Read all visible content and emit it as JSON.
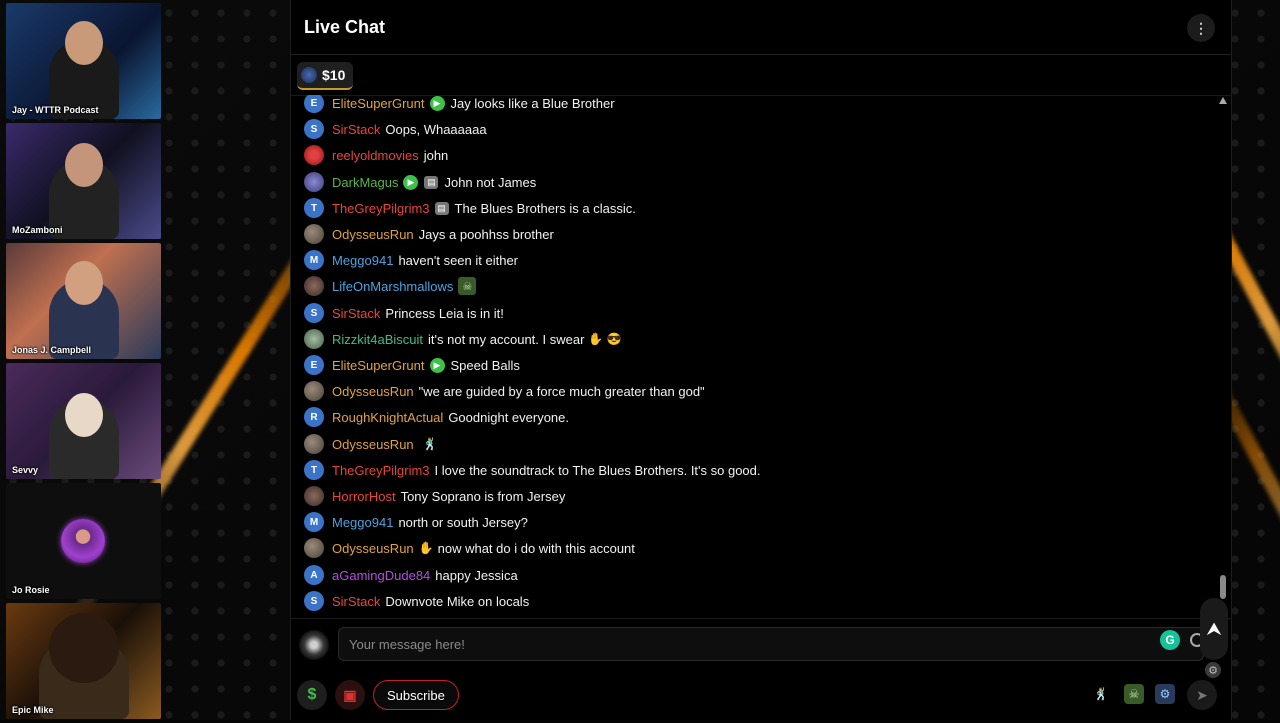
{
  "webcams": [
    {
      "name": "Jay - WTTR Podcast"
    },
    {
      "name": "MoZamboni"
    },
    {
      "name": "Jonas J. Campbell"
    },
    {
      "name": "Sevvy"
    },
    {
      "name": "Jo Rosie"
    },
    {
      "name": "Epic Mike"
    }
  ],
  "chat": {
    "title": "Live Chat",
    "menu_icon": "more-vertical-icon",
    "tip": {
      "amount": "$10"
    },
    "messages": [
      {
        "user": "EliteSuperGrunt",
        "color": "#e3a33b",
        "avatar": "E",
        "avatar_style": "",
        "badges": [
          "green"
        ],
        "text": "Jay looks like a Blue Brother"
      },
      {
        "user": "SirStack",
        "color": "#e8453c",
        "avatar": "S",
        "avatar_style": "",
        "badges": [],
        "text": "Oops, Whaaaaaa"
      },
      {
        "user": "reelyoldmovies",
        "color": "#e8453c",
        "avatar": "",
        "avatar_style": "red",
        "badges": [],
        "text": "john"
      },
      {
        "user": "DarkMagus",
        "color": "#5bb548",
        "avatar": "",
        "avatar_style": "purple",
        "badges": [
          "green",
          "grey"
        ],
        "text": "John not James"
      },
      {
        "user": "TheGreyPilgrim3",
        "color": "#e8453c",
        "avatar": "T",
        "avatar_style": "",
        "badges": [
          "grey"
        ],
        "text": "The Blues Brothers is a classic."
      },
      {
        "user": "OdysseusRun",
        "color": "#e3a33b",
        "avatar": "",
        "avatar_style": "photo",
        "badges": [],
        "text": "Jays a poohhss brother"
      },
      {
        "user": "Meggo941",
        "color": "#4aa3df",
        "avatar": "M",
        "avatar_style": "",
        "badges": [],
        "text": "haven't seen it either"
      },
      {
        "user": "LifeOnMarshmallows",
        "color": "#4aa3df",
        "avatar": "",
        "avatar_style": "dark",
        "badges": [
          "skull"
        ],
        "text": ""
      },
      {
        "user": "SirStack",
        "color": "#e8453c",
        "avatar": "S",
        "avatar_style": "",
        "badges": [],
        "text": "Princess Leia is in it!"
      },
      {
        "user": "Rizzkit4aBiscuit",
        "color": "#3fbf7f",
        "avatar": "",
        "avatar_style": "green",
        "badges": [],
        "text": "it's not my account. I swear",
        "emoji": "✋ 😎"
      },
      {
        "user": "EliteSuperGrunt",
        "color": "#e3a33b",
        "avatar": "E",
        "avatar_style": "",
        "badges": [
          "green"
        ],
        "text": "Speed Balls"
      },
      {
        "user": "OdysseusRun",
        "color": "#e3a33b",
        "avatar": "",
        "avatar_style": "photo",
        "badges": [],
        "text": "\"we are guided by a force much greater than god\""
      },
      {
        "user": "RoughKnightActual",
        "color": "#e3a33b",
        "avatar": "R",
        "avatar_style": "",
        "badges": [],
        "text": "Goodnight everyone."
      },
      {
        "user": "OdysseusRun",
        "color": "#e3a33b",
        "avatar": "",
        "avatar_style": "photo",
        "badges": [],
        "text": "",
        "emoji": "🕺"
      },
      {
        "user": "TheGreyPilgrim3",
        "color": "#e8453c",
        "avatar": "T",
        "avatar_style": "",
        "badges": [],
        "text": "I love the soundtrack to The Blues Brothers. It's so good."
      },
      {
        "user": "HorrorHost",
        "color": "#e8453c",
        "avatar": "",
        "avatar_style": "dark",
        "badges": [],
        "text": "Tony Soprano is from Jersey"
      },
      {
        "user": "Meggo941",
        "color": "#4aa3df",
        "avatar": "M",
        "avatar_style": "",
        "badges": [],
        "text": "north or south Jersey?"
      },
      {
        "user": "OdysseusRun",
        "color": "#e3a33b",
        "avatar": "",
        "avatar_style": "photo",
        "badges": [],
        "text": "now what do i do with this account",
        "emoji_before": "✋"
      },
      {
        "user": "aGamingDude84",
        "color": "#b44fe0",
        "avatar": "A",
        "avatar_style": "",
        "badges": [],
        "text": "happy Jessica"
      },
      {
        "user": "SirStack",
        "color": "#e8453c",
        "avatar": "S",
        "avatar_style": "",
        "badges": [],
        "text": "Downvote Mike on locals"
      }
    ],
    "input": {
      "placeholder": "Your message here!"
    },
    "bottom": {
      "subscribe_label": "Subscribe",
      "dollar_icon": "$",
      "gift_icon": "gift-icon"
    }
  }
}
